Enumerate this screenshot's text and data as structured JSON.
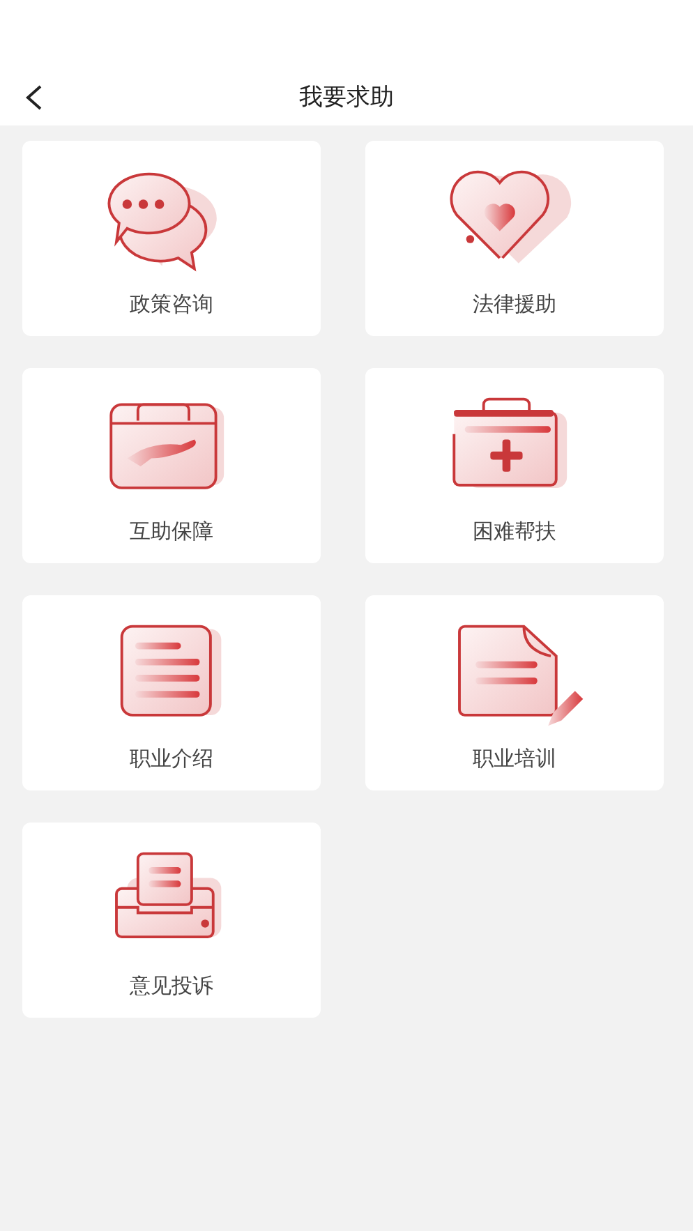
{
  "header": {
    "title": "我要求助"
  },
  "services": [
    {
      "label": "政策咨询",
      "kind": "chat"
    },
    {
      "label": "法律援助",
      "kind": "heart"
    },
    {
      "label": "互助保障",
      "kind": "case-hand"
    },
    {
      "label": "困难帮扶",
      "kind": "medkit"
    },
    {
      "label": "职业介绍",
      "kind": "document"
    },
    {
      "label": "职业培训",
      "kind": "document-pen"
    },
    {
      "label": "意见投诉",
      "kind": "tray"
    }
  ]
}
